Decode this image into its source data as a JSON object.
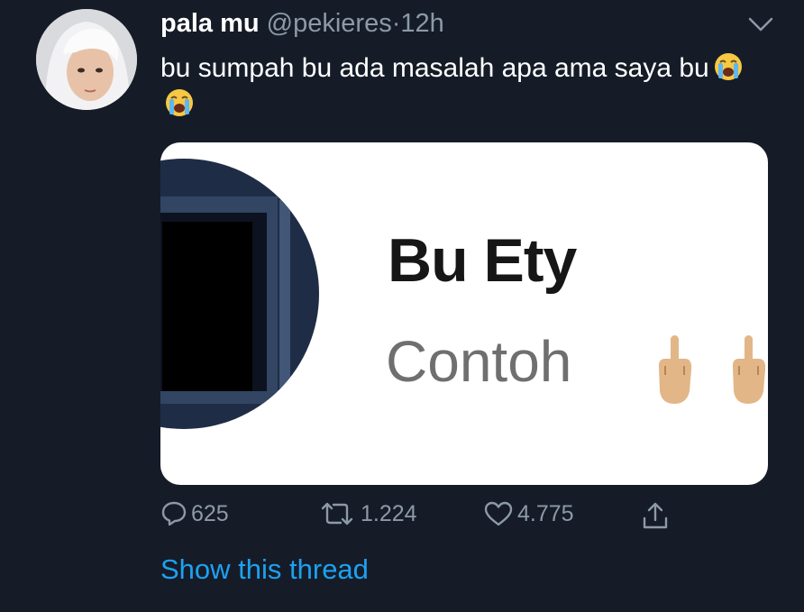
{
  "tweet": {
    "display_name": "pala mu",
    "handle": "@pekieres",
    "separator": "·",
    "time": "12h",
    "text": "bu sumpah bu ada masalah apa ama saya bu",
    "text_emojis": [
      "loudly-crying-face",
      "loudly-crying-face"
    ]
  },
  "card": {
    "title": "Bu Ety",
    "subtitle": "Contoh",
    "subtitle_emojis": [
      "middle-finger",
      "middle-finger"
    ]
  },
  "actions": {
    "replies": "625",
    "retweets": "1.224",
    "likes": "4.775"
  },
  "show_thread": "Show this thread",
  "colors": {
    "background": "#151c28",
    "secondary_text": "#8d99a6",
    "link": "#1da1f2"
  }
}
